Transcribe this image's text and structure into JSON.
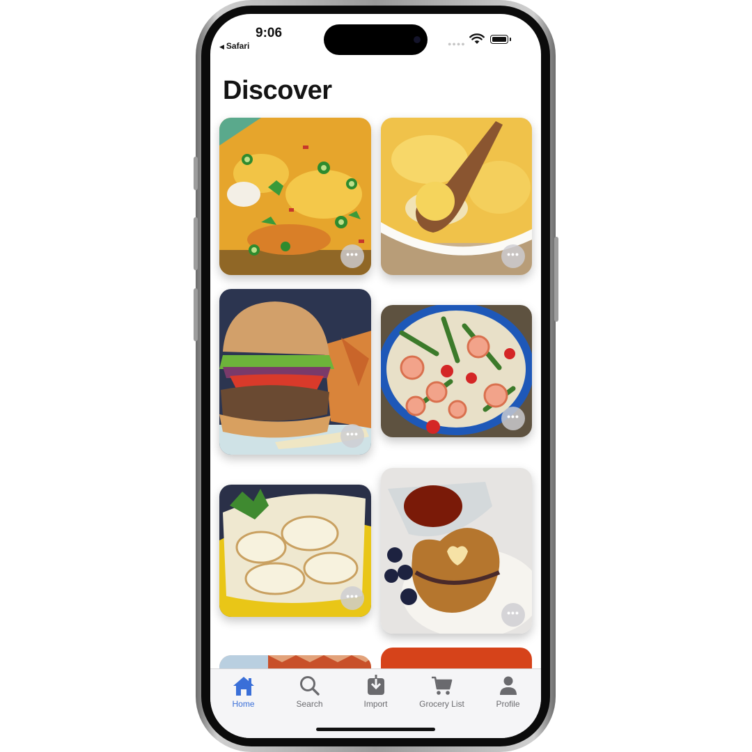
{
  "status_bar": {
    "time": "9:06",
    "back_app": "Safari"
  },
  "page": {
    "title": "Discover"
  },
  "recipe_grid": {
    "more_label": "•••",
    "cards": [
      {
        "id": "card-1",
        "image": "cheesy casserole with jalapeños"
      },
      {
        "id": "card-2",
        "image": "potato casserole with wooden spoon"
      },
      {
        "id": "card-3",
        "image": "burger with fries"
      },
      {
        "id": "card-4",
        "image": "shrimp pasta salad"
      },
      {
        "id": "card-5",
        "image": "scalloped potatoes"
      },
      {
        "id": "card-6",
        "image": "heart pancakes with syrup"
      }
    ]
  },
  "tab_bar": {
    "active_tab": "home",
    "items": [
      {
        "key": "home",
        "label": "Home",
        "icon": "house-icon"
      },
      {
        "key": "search",
        "label": "Search",
        "icon": "magnifier-icon"
      },
      {
        "key": "import",
        "label": "Import",
        "icon": "import-tray-icon"
      },
      {
        "key": "grocery",
        "label": "Grocery List",
        "icon": "shopping-cart-icon"
      },
      {
        "key": "profile",
        "label": "Profile",
        "icon": "person-icon"
      }
    ]
  },
  "colors": {
    "accent": "#3a6fd8",
    "tab_inactive": "#6a6a6e",
    "tab_bar_bg": "#f5f5f7"
  }
}
